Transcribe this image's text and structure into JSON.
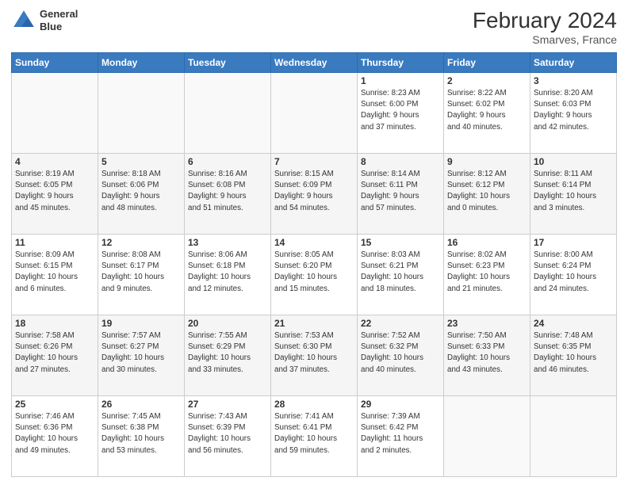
{
  "header": {
    "logo_line1": "General",
    "logo_line2": "Blue",
    "month": "February 2024",
    "location": "Smarves, France"
  },
  "days_of_week": [
    "Sunday",
    "Monday",
    "Tuesday",
    "Wednesday",
    "Thursday",
    "Friday",
    "Saturday"
  ],
  "weeks": [
    [
      {
        "day": "",
        "info": ""
      },
      {
        "day": "",
        "info": ""
      },
      {
        "day": "",
        "info": ""
      },
      {
        "day": "",
        "info": ""
      },
      {
        "day": "1",
        "info": "Sunrise: 8:23 AM\nSunset: 6:00 PM\nDaylight: 9 hours\nand 37 minutes."
      },
      {
        "day": "2",
        "info": "Sunrise: 8:22 AM\nSunset: 6:02 PM\nDaylight: 9 hours\nand 40 minutes."
      },
      {
        "day": "3",
        "info": "Sunrise: 8:20 AM\nSunset: 6:03 PM\nDaylight: 9 hours\nand 42 minutes."
      }
    ],
    [
      {
        "day": "4",
        "info": "Sunrise: 8:19 AM\nSunset: 6:05 PM\nDaylight: 9 hours\nand 45 minutes."
      },
      {
        "day": "5",
        "info": "Sunrise: 8:18 AM\nSunset: 6:06 PM\nDaylight: 9 hours\nand 48 minutes."
      },
      {
        "day": "6",
        "info": "Sunrise: 8:16 AM\nSunset: 6:08 PM\nDaylight: 9 hours\nand 51 minutes."
      },
      {
        "day": "7",
        "info": "Sunrise: 8:15 AM\nSunset: 6:09 PM\nDaylight: 9 hours\nand 54 minutes."
      },
      {
        "day": "8",
        "info": "Sunrise: 8:14 AM\nSunset: 6:11 PM\nDaylight: 9 hours\nand 57 minutes."
      },
      {
        "day": "9",
        "info": "Sunrise: 8:12 AM\nSunset: 6:12 PM\nDaylight: 10 hours\nand 0 minutes."
      },
      {
        "day": "10",
        "info": "Sunrise: 8:11 AM\nSunset: 6:14 PM\nDaylight: 10 hours\nand 3 minutes."
      }
    ],
    [
      {
        "day": "11",
        "info": "Sunrise: 8:09 AM\nSunset: 6:15 PM\nDaylight: 10 hours\nand 6 minutes."
      },
      {
        "day": "12",
        "info": "Sunrise: 8:08 AM\nSunset: 6:17 PM\nDaylight: 10 hours\nand 9 minutes."
      },
      {
        "day": "13",
        "info": "Sunrise: 8:06 AM\nSunset: 6:18 PM\nDaylight: 10 hours\nand 12 minutes."
      },
      {
        "day": "14",
        "info": "Sunrise: 8:05 AM\nSunset: 6:20 PM\nDaylight: 10 hours\nand 15 minutes."
      },
      {
        "day": "15",
        "info": "Sunrise: 8:03 AM\nSunset: 6:21 PM\nDaylight: 10 hours\nand 18 minutes."
      },
      {
        "day": "16",
        "info": "Sunrise: 8:02 AM\nSunset: 6:23 PM\nDaylight: 10 hours\nand 21 minutes."
      },
      {
        "day": "17",
        "info": "Sunrise: 8:00 AM\nSunset: 6:24 PM\nDaylight: 10 hours\nand 24 minutes."
      }
    ],
    [
      {
        "day": "18",
        "info": "Sunrise: 7:58 AM\nSunset: 6:26 PM\nDaylight: 10 hours\nand 27 minutes."
      },
      {
        "day": "19",
        "info": "Sunrise: 7:57 AM\nSunset: 6:27 PM\nDaylight: 10 hours\nand 30 minutes."
      },
      {
        "day": "20",
        "info": "Sunrise: 7:55 AM\nSunset: 6:29 PM\nDaylight: 10 hours\nand 33 minutes."
      },
      {
        "day": "21",
        "info": "Sunrise: 7:53 AM\nSunset: 6:30 PM\nDaylight: 10 hours\nand 37 minutes."
      },
      {
        "day": "22",
        "info": "Sunrise: 7:52 AM\nSunset: 6:32 PM\nDaylight: 10 hours\nand 40 minutes."
      },
      {
        "day": "23",
        "info": "Sunrise: 7:50 AM\nSunset: 6:33 PM\nDaylight: 10 hours\nand 43 minutes."
      },
      {
        "day": "24",
        "info": "Sunrise: 7:48 AM\nSunset: 6:35 PM\nDaylight: 10 hours\nand 46 minutes."
      }
    ],
    [
      {
        "day": "25",
        "info": "Sunrise: 7:46 AM\nSunset: 6:36 PM\nDaylight: 10 hours\nand 49 minutes."
      },
      {
        "day": "26",
        "info": "Sunrise: 7:45 AM\nSunset: 6:38 PM\nDaylight: 10 hours\nand 53 minutes."
      },
      {
        "day": "27",
        "info": "Sunrise: 7:43 AM\nSunset: 6:39 PM\nDaylight: 10 hours\nand 56 minutes."
      },
      {
        "day": "28",
        "info": "Sunrise: 7:41 AM\nSunset: 6:41 PM\nDaylight: 10 hours\nand 59 minutes."
      },
      {
        "day": "29",
        "info": "Sunrise: 7:39 AM\nSunset: 6:42 PM\nDaylight: 11 hours\nand 2 minutes."
      },
      {
        "day": "",
        "info": ""
      },
      {
        "day": "",
        "info": ""
      }
    ]
  ]
}
